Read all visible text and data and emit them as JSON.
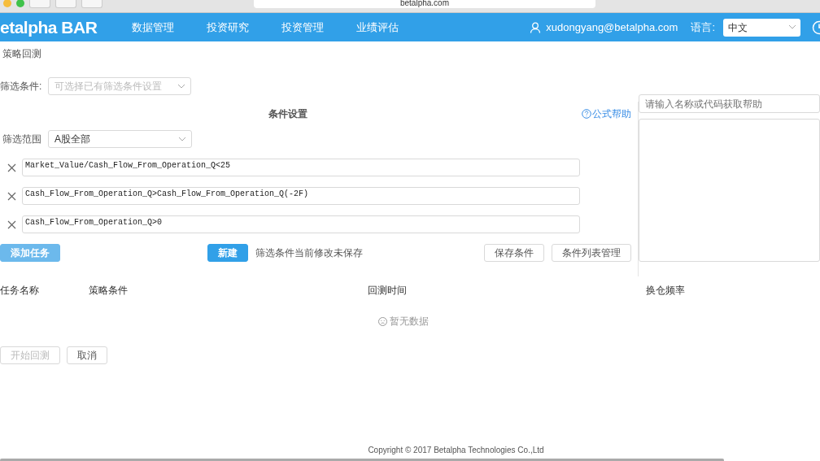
{
  "browser": {
    "url": "betalpha.com"
  },
  "nav": {
    "logo": "etalpha BAR",
    "items": [
      {
        "label": "数据管理"
      },
      {
        "label": "投资研究"
      },
      {
        "label": "投资管理"
      },
      {
        "label": "业绩评估"
      }
    ],
    "user": "xudongyang@betalpha.com",
    "language_label": "语言:",
    "language_value": "中文"
  },
  "breadcrumb": "策略回测",
  "preset": {
    "label": "筛选条件:",
    "placeholder": "可选择已有筛选条件设置"
  },
  "section_title": "条件设置",
  "formula_help": "公式帮助",
  "help_search": {
    "placeholder": "请输入名称或代码获取帮助"
  },
  "scope": {
    "label": "筛选范围",
    "value": "A股全部"
  },
  "conditions": [
    {
      "value": "Market_Value/Cash_Flow_From_Operation_Q<25"
    },
    {
      "value": "Cash_Flow_From_Operation_Q>Cash_Flow_From_Operation_Q(-2F)"
    },
    {
      "value": "Cash_Flow_From_Operation_Q>0"
    }
  ],
  "add_task": {
    "label": "添加任务",
    "hovered": true
  },
  "new_button": "新建",
  "unsaved_note": "筛选条件当前修改未保存",
  "save_button": "保存条件",
  "manage_button": "条件列表管理",
  "table": {
    "columns": [
      "任务名称",
      "策略条件",
      "回测时间",
      "换仓频率"
    ],
    "empty_text": "暂无数据"
  },
  "actions": [
    {
      "label": "开始回测",
      "disabled": true
    },
    {
      "label": "取消",
      "disabled": false
    }
  ],
  "footer": "Copyright © 2017 Betalpha Technologies Co.,Ltd"
}
